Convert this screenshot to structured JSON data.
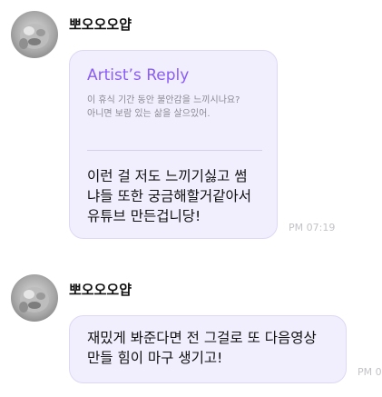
{
  "messages": [
    {
      "sender": "뽀오오오얍",
      "avatar_icon": "profile-photo-avatar",
      "reply": {
        "title": "Artist’s Reply",
        "quote_lines": [
          "이 휴식 기간 동안 불안감을 느끼시나요?",
          "아니면 보람 있는 삶을 살으있어."
        ]
      },
      "text_lines": [
        "이런 걸 저도 느끼기싫고 썸",
        "냐들 또한 궁금해할거같아서",
        "유튜브 만든겁니당!"
      ],
      "time": "PM 07:19"
    },
    {
      "sender": "뽀오오오얍",
      "avatar_icon": "profile-photo-avatar",
      "text_lines": [
        "재밌게 봐준다면 전 그걸로 또 다음영상",
        "만들 힘이 마구 생기고!"
      ],
      "time": "PM 0"
    }
  ],
  "colors": {
    "bubble_bg": "#f1effd",
    "bubble_border": "#ddd8f6",
    "accent": "#8b5cf6",
    "time": "#c3c3c8"
  }
}
